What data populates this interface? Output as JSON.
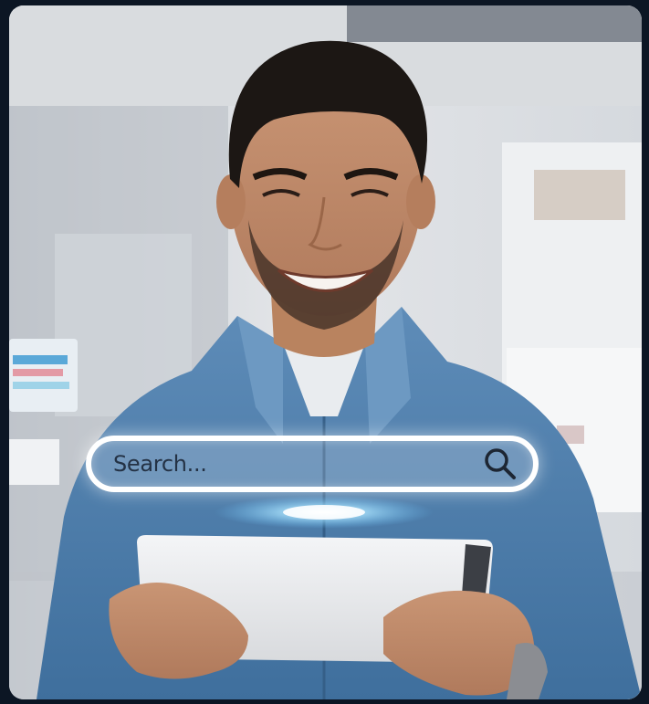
{
  "search": {
    "placeholder": "Search..."
  },
  "icons": {
    "search": "magnifier-icon"
  },
  "colors": {
    "background": "#0c1624",
    "search_border": "#ffffff",
    "search_text": "#243245",
    "shirt": "#4f7fac"
  }
}
